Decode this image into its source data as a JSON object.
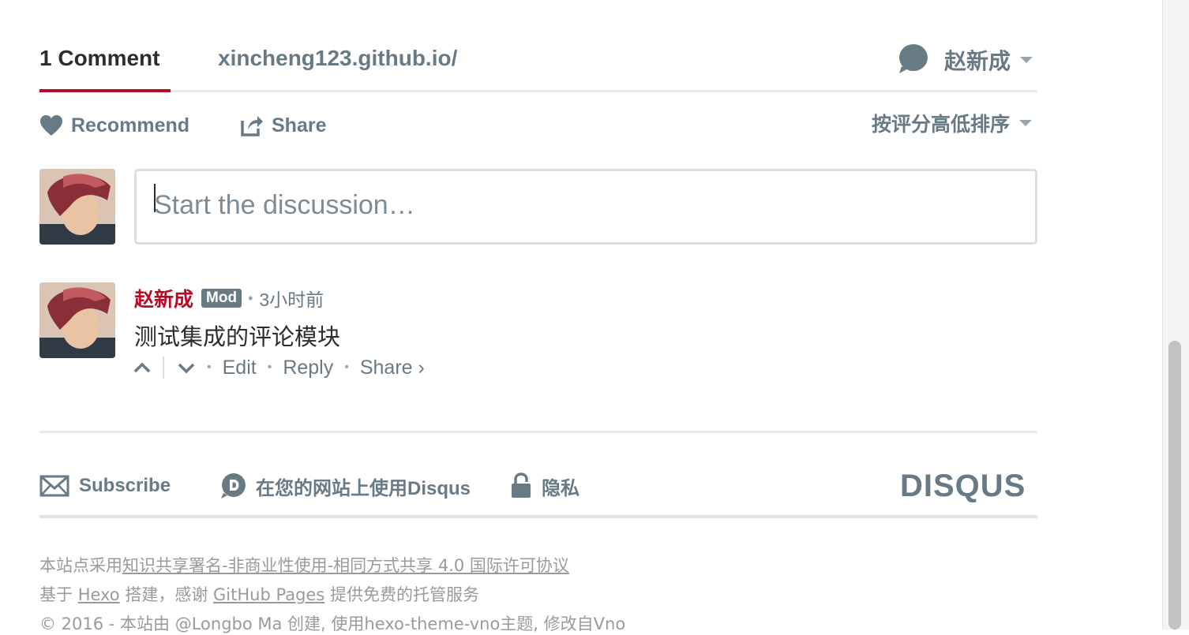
{
  "nav": {
    "comment_count": "1 Comment",
    "site_tab": "xincheng123.github.io/",
    "user_name": "赵新成"
  },
  "actions": {
    "recommend_label": "Recommend",
    "share_label": "Share",
    "sort_label": "按评分高低排序"
  },
  "composer": {
    "placeholder": "Start the discussion…"
  },
  "comment": {
    "author": "赵新成",
    "badge": "Mod",
    "time": "3小时前",
    "body": "测试集成的评论模块",
    "edit_label": "Edit",
    "reply_label": "Reply",
    "share_label": "Share ›"
  },
  "disqus_footer": {
    "subscribe_label": "Subscribe",
    "use_label": "在您的网站上使用Disqus",
    "privacy_label": "隐私",
    "logo_text": "DISQUS"
  },
  "site_footer": {
    "line1_prefix": "本站点采用",
    "line1_link": "知识共享署名-非商业性使用-相同方式共享 4.0 国际许可协议",
    "line2_prefix": "基于 ",
    "line2_link1": "Hexo",
    "line2_mid": " 搭建，感谢 ",
    "line2_link2": "GitHub Pages",
    "line2_suffix": " 提供免费的托管服务",
    "line3": "© 2016 - 本站由 @Longbo Ma 创建, 使用hexo-theme-vno主题, 修改自Vno"
  },
  "colors": {
    "accent": "#b70a25",
    "text_muted": "#687a86",
    "text_dark": "#2a2e2e",
    "rule": "#e7e9ee"
  }
}
